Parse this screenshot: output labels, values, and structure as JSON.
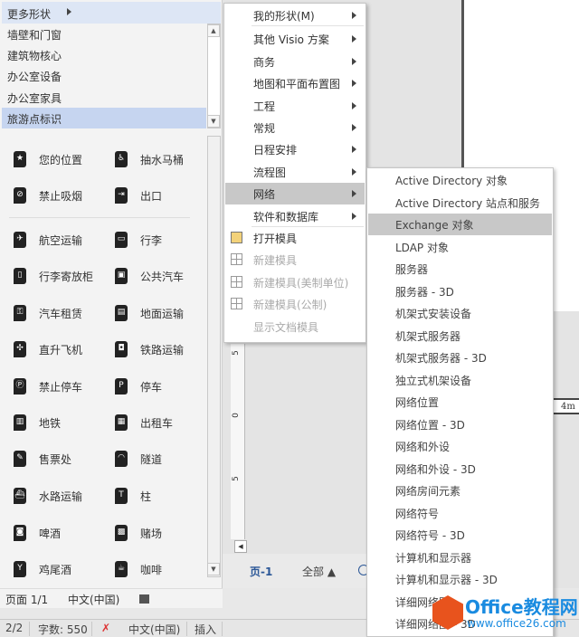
{
  "panel": {
    "more_shapes": "更多形状",
    "categories": [
      {
        "label": "墙壁和门窗"
      },
      {
        "label": "建筑物核心"
      },
      {
        "label": "办公室设备"
      },
      {
        "label": "办公室家具"
      },
      {
        "label": "旅游点标识",
        "selected": true
      }
    ],
    "shapes": [
      {
        "label": "您的位置",
        "icon": "★"
      },
      {
        "label": "抽水马桶",
        "icon": "♿"
      },
      {
        "label": "禁止吸烟",
        "icon": "⊘"
      },
      {
        "label": "出口",
        "icon": "⇥"
      },
      {
        "label": "航空运输",
        "icon": "✈"
      },
      {
        "label": "行李",
        "icon": "▭"
      },
      {
        "label": "行李寄放柜",
        "icon": "▯"
      },
      {
        "label": "公共汽车",
        "icon": "▣"
      },
      {
        "label": "汽车租赁",
        "icon": "⚿"
      },
      {
        "label": "地面运输",
        "icon": "▤"
      },
      {
        "label": "直升飞机",
        "icon": "✣"
      },
      {
        "label": "铁路运输",
        "icon": "◘"
      },
      {
        "label": "禁止停车",
        "icon": "Ⓟ"
      },
      {
        "label": "停车",
        "icon": "P"
      },
      {
        "label": "地铁",
        "icon": "▥"
      },
      {
        "label": "出租车",
        "icon": "▦"
      },
      {
        "label": "售票处",
        "icon": "✎"
      },
      {
        "label": "隧道",
        "icon": "◠"
      },
      {
        "label": "水路运输",
        "icon": "⛴"
      },
      {
        "label": "柱",
        "icon": "T"
      },
      {
        "label": "啤酒",
        "icon": "◙"
      },
      {
        "label": "赌场",
        "icon": "▩"
      },
      {
        "label": "鸡尾酒",
        "icon": "Y"
      },
      {
        "label": "咖啡",
        "icon": "☕"
      }
    ],
    "status_page": "页面 1/1",
    "status_lang": "中文(中国)"
  },
  "menu": {
    "items": [
      {
        "label": "我的形状(M)",
        "submenu": true
      },
      {
        "label": "其他 Visio 方案",
        "submenu": true
      },
      {
        "label": "商务",
        "submenu": true
      },
      {
        "label": "地图和平面布置图",
        "submenu": true
      },
      {
        "label": "工程",
        "submenu": true
      },
      {
        "label": "常规",
        "submenu": true
      },
      {
        "label": "日程安排",
        "submenu": true
      },
      {
        "label": "流程图",
        "submenu": true
      },
      {
        "label": "网络",
        "submenu": true,
        "highlighted": true
      },
      {
        "label": "软件和数据库",
        "submenu": true
      },
      {
        "label": "打开模具",
        "icon": "open-stencil-icon"
      },
      {
        "label": "新建模具",
        "icon": "grid-icon",
        "disabled": true
      },
      {
        "label": "新建模具(美制单位)",
        "icon": "grid-icon",
        "disabled": true
      },
      {
        "label": "新建模具(公制)",
        "icon": "grid-icon",
        "disabled": true
      },
      {
        "label": "显示文档模具",
        "disabled": true
      }
    ]
  },
  "submenu": {
    "items": [
      {
        "label": "Active Directory 对象"
      },
      {
        "label": "Active Directory 站点和服务"
      },
      {
        "label": "Exchange 对象",
        "highlighted": true
      },
      {
        "label": "LDAP 对象"
      },
      {
        "label": "服务器"
      },
      {
        "label": "服务器 - 3D"
      },
      {
        "label": "机架式安装设备"
      },
      {
        "label": "机架式服务器"
      },
      {
        "label": "机架式服务器 - 3D"
      },
      {
        "label": "独立式机架设备"
      },
      {
        "label": "网络位置"
      },
      {
        "label": "网络位置 - 3D"
      },
      {
        "label": "网络和外设"
      },
      {
        "label": "网络和外设 - 3D"
      },
      {
        "label": "网络房间元素"
      },
      {
        "label": "网络符号"
      },
      {
        "label": "网络符号 - 3D"
      },
      {
        "label": "计算机和显示器"
      },
      {
        "label": "计算机和显示器 - 3D"
      },
      {
        "label": "详细网络图"
      },
      {
        "label": "详细网络图 - 3D"
      }
    ]
  },
  "canvas": {
    "page_tab": "页-1",
    "all_tab": "全部 ▲",
    "ruler": [
      "5",
      "0",
      "5"
    ],
    "dimension": "4m"
  },
  "statusbar": {
    "pages": "2/2",
    "words": "字数: 550",
    "lang": "中文(中国)",
    "mode": "插入"
  },
  "watermark": {
    "title": "Office教程网",
    "url": "www.office26.com"
  },
  "colors": {
    "selected": "#c6d5f0",
    "menu_highlight": "#c8c8c8",
    "watermark": "#1a8be0",
    "logo": "#e8531d"
  }
}
